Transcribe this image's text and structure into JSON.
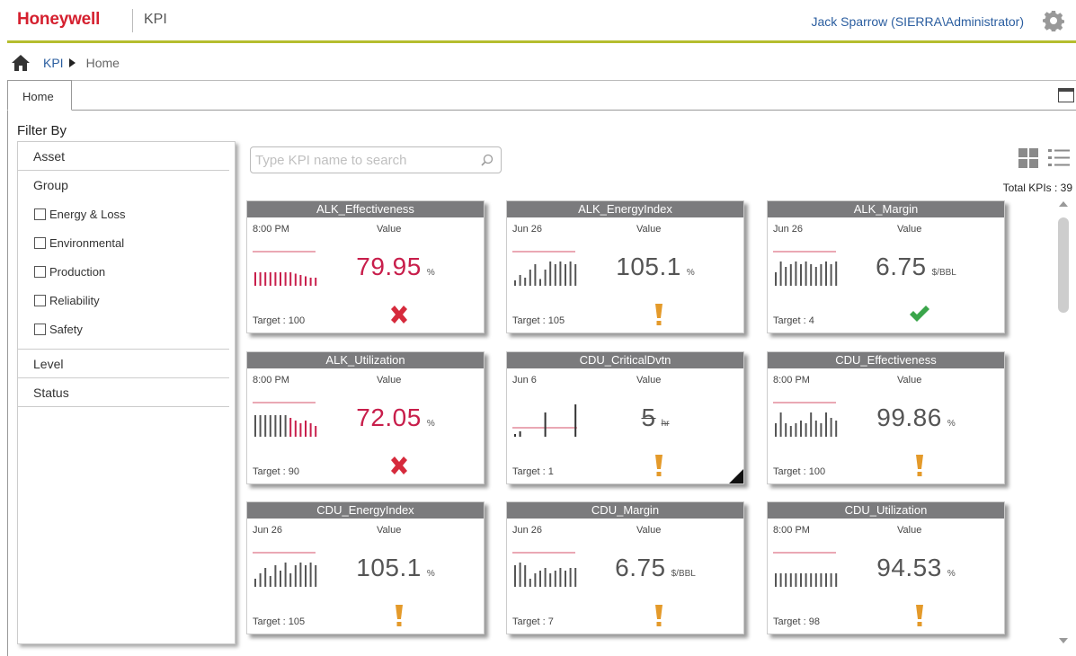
{
  "header": {
    "brand": "Honeywell",
    "app_title": "KPI",
    "user": "Jack Sparrow (SIERRA\\Administrator)",
    "accent": "#b5bd2e",
    "brand_color": "#d5202f"
  },
  "breadcrumb": {
    "root": "KPI",
    "current": "Home"
  },
  "tabs": {
    "home": "Home"
  },
  "filter": {
    "title": "Filter By",
    "sections": {
      "asset": "Asset",
      "group": "Group",
      "level": "Level",
      "status": "Status"
    },
    "group_options": [
      "Energy & Loss",
      "Environmental",
      "Production",
      "Reliability",
      "Safety"
    ]
  },
  "search": {
    "placeholder": "Type KPI name to search"
  },
  "total": "Total KPIs : 39",
  "cards": [
    {
      "title": "ALK_Effectiveness",
      "date": "8:00 PM",
      "value_label": "Value",
      "value": "79.95",
      "unit": "%",
      "target": "Target : 100",
      "status": "bad",
      "value_color": "red"
    },
    {
      "title": "ALK_EnergyIndex",
      "date": "Jun 26",
      "value_label": "Value",
      "value": "105.1",
      "unit": "%",
      "target": "Target : 105",
      "status": "warning",
      "value_color": "gray"
    },
    {
      "title": "ALK_Margin",
      "date": "Jun 26",
      "value_label": "Value",
      "value": "6.75",
      "unit": "$/BBL",
      "target": "Target : 4",
      "status": "good",
      "value_color": "gray"
    },
    {
      "title": "ALK_Utilization",
      "date": "8:00 PM",
      "value_label": "Value",
      "value": "72.05",
      "unit": "%",
      "target": "Target : 90",
      "status": "bad",
      "value_color": "red"
    },
    {
      "title": "CDU_CriticalDvtn",
      "date": "Jun 6",
      "value_label": "Value",
      "value": "5",
      "unit": "hr",
      "target": "Target : 1",
      "status": "warning",
      "value_color": "gray"
    },
    {
      "title": "CDU_Effectiveness",
      "date": "8:00 PM",
      "value_label": "Value",
      "value": "99.86",
      "unit": "%",
      "target": "Target : 100",
      "status": "warning",
      "value_color": "gray"
    },
    {
      "title": "CDU_EnergyIndex",
      "date": "Jun 26",
      "value_label": "Value",
      "value": "105.1",
      "unit": "%",
      "target": "Target : 105",
      "status": "warning",
      "value_color": "gray"
    },
    {
      "title": "CDU_Margin",
      "date": "Jun 26",
      "value_label": "Value",
      "value": "6.75",
      "unit": "$/BBL",
      "target": "Target : 7",
      "status": "warning",
      "value_color": "gray"
    },
    {
      "title": "CDU_Utilization",
      "date": "8:00 PM",
      "value_label": "Value",
      "value": "94.53",
      "unit": "%",
      "target": "Target : 98",
      "status": "warning",
      "value_color": "gray"
    }
  ],
  "colors": {
    "title_bar": "#7b7b7d",
    "bad": "#d62a3c",
    "warning": "#e49a2a",
    "good": "#3aa54a",
    "red_value": "#c81e4b"
  }
}
